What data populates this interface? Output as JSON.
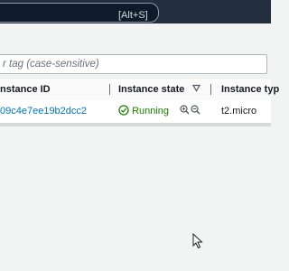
{
  "topbar": {
    "search_shortcut": "[Alt+S]"
  },
  "filter": {
    "placeholder": "r tag (case-sensitive)"
  },
  "table": {
    "columns": [
      "nstance ID",
      "Instance state",
      "Instance typ"
    ],
    "rows": [
      {
        "instance_id": "09c4e7ee19b2dcc2",
        "state": "Running",
        "type": "t2.micro"
      }
    ]
  },
  "colors": {
    "running": "#1d8102",
    "link": "#0073bb",
    "topbar": "#232f3e"
  }
}
